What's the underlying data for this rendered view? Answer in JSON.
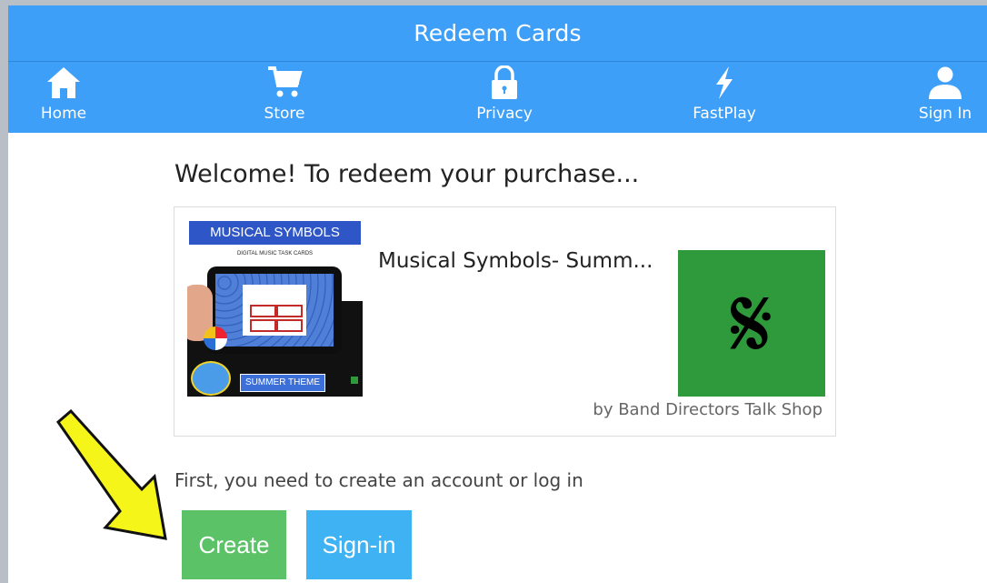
{
  "header": {
    "title": "Redeem Cards"
  },
  "nav": {
    "items": [
      {
        "label": "Home",
        "icon": "home-icon"
      },
      {
        "label": "Store",
        "icon": "cart-icon"
      },
      {
        "label": "Privacy",
        "icon": "lock-icon"
      },
      {
        "label": "FastPlay",
        "icon": "lightning-icon"
      },
      {
        "label": "Sign In",
        "icon": "user-icon"
      }
    ]
  },
  "main": {
    "welcome": "Welcome! To redeem your purchase...",
    "product": {
      "title": "Musical Symbols- Summ...",
      "author": "by Band Directors Talk Shop",
      "thumbnail_title": "MUSICAL SYMBOLS",
      "thumbnail_subtitle": "DIGITAL MUSIC TASK CARDS",
      "thumbnail_footer": "SUMMER THEME",
      "logo_glyph": "𝄋"
    },
    "prompt": "First, you need to create an account or log in",
    "buttons": {
      "create": "Create",
      "signin": "Sign-in"
    }
  },
  "colors": {
    "header": "#3e9ff8",
    "create": "#5cc268",
    "signin": "#3eb2f3",
    "logo_bg": "#2f9a3b",
    "arrow": "#f5f51a"
  }
}
